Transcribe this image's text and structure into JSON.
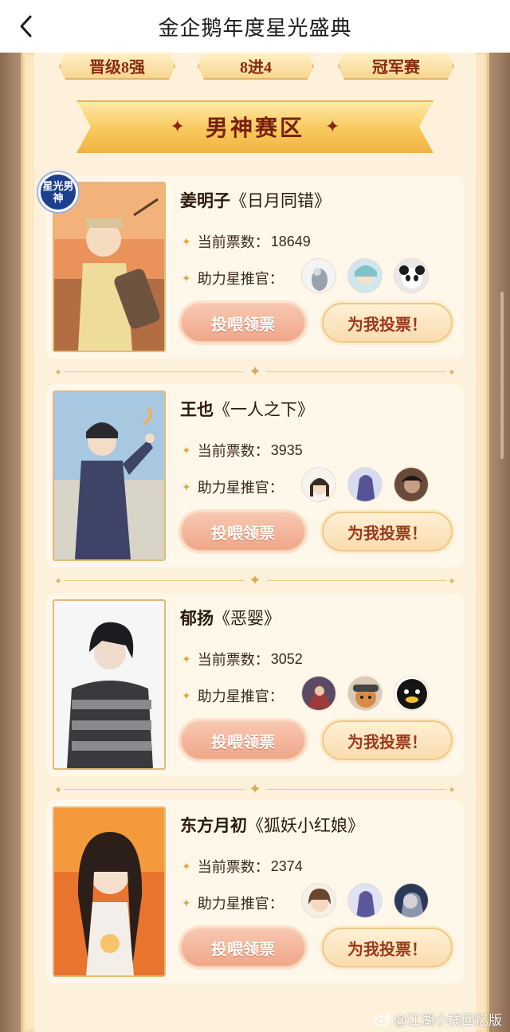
{
  "nav": {
    "title": "金企鹅年度星光盛典"
  },
  "round_tabs": [
    {
      "label": "晋级8强"
    },
    {
      "label": "8进4"
    },
    {
      "label": "冠军赛"
    }
  ],
  "section": {
    "title": "男神赛区"
  },
  "labels": {
    "votes_prefix": "当前票数：",
    "supporters_prefix": "助力星推官：",
    "earn_button": "投喂领票",
    "vote_button": "为我投票！"
  },
  "candidates": [
    {
      "name": "姜明子",
      "work": "《日月同错》",
      "votes": "18649",
      "badge": "星光男神"
    },
    {
      "name": "王也",
      "work": "《一人之下》",
      "votes": "3935"
    },
    {
      "name": "郁扬",
      "work": "《恶婴》",
      "votes": "3052"
    },
    {
      "name": "东方月初",
      "work": "《狐妖小红娘》",
      "votes": "2374"
    }
  ],
  "watermark": "@江湖小栈回忆版",
  "colors": {
    "accent_red": "#8a2a12",
    "panel_bg": "#fdf1dc",
    "gold": "#e2b564",
    "badge_blue": "#1d3f8e"
  },
  "icons": {
    "back": "chevron-left-icon",
    "bullet": "sparkle-star-icon",
    "watermark": "weibo-icon"
  }
}
